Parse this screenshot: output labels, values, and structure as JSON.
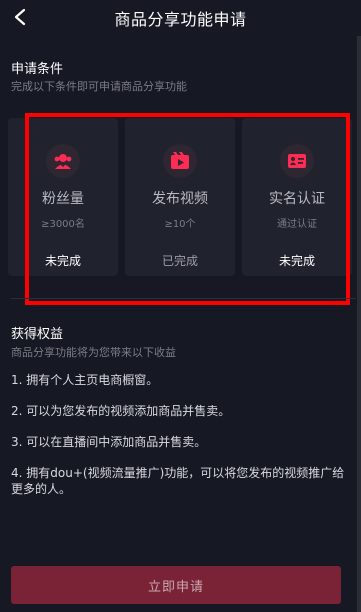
{
  "header": {
    "title": "商品分享功能申请",
    "back_icon": "chevron-left-icon"
  },
  "conditions": {
    "title": "申请条件",
    "subtitle": "完成以下条件即可申请商品分享功能",
    "cards": [
      {
        "icon": "fans-icon",
        "name": "粉丝量",
        "requirement": "≥3000名",
        "status": "未完成",
        "done": false
      },
      {
        "icon": "video-icon",
        "name": "发布视频",
        "requirement": "≥10个",
        "status": "已完成",
        "done": true
      },
      {
        "icon": "id-card-icon",
        "name": "实名认证",
        "requirement": "通过认证",
        "status": "未完成",
        "done": false
      }
    ]
  },
  "benefits": {
    "title": "获得权益",
    "subtitle": "商品分享功能将为您带来以下收益",
    "items": [
      "1. 拥有个人主页电商橱窗。",
      "2. 可以为您发布的视频添加商品并售卖。",
      "3. 可以在直播间中添加商品并售卖。",
      "4. 拥有dou+(视频流量推广)功能，可以将您发布的视频推广给更多的人。"
    ]
  },
  "apply_button": {
    "label": "立即申请"
  },
  "colors": {
    "background": "#161823",
    "card": "#20222d",
    "accent": "#fe2c55",
    "button_disabled": "#7a2236",
    "highlight": "#ff0000"
  }
}
